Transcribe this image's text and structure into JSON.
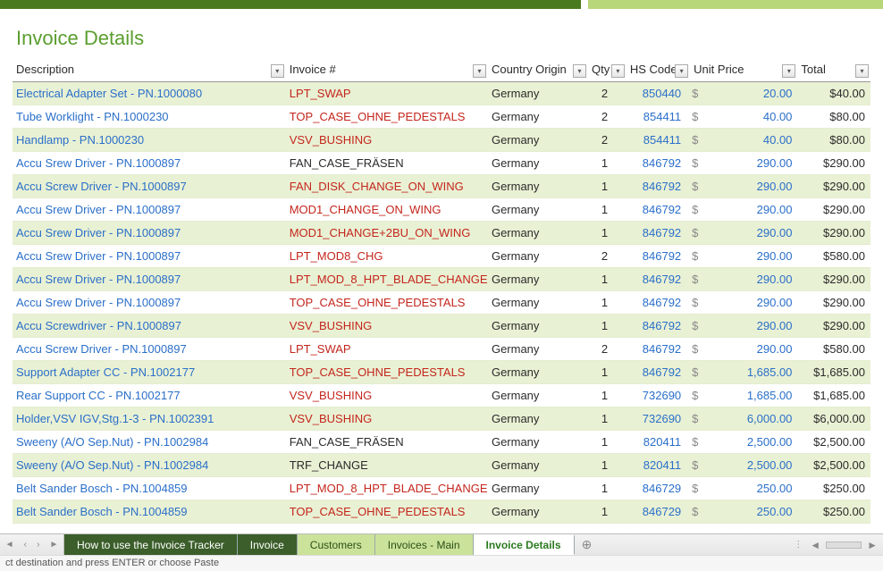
{
  "title": "Invoice Details",
  "columns": {
    "description": "Description",
    "invoice": "Invoice #",
    "origin": "Country Origin",
    "qty": "Qty",
    "hs": "HS Code",
    "unit": "Unit Price",
    "total": "Total"
  },
  "currency_symbol": "$",
  "rows": [
    {
      "desc": "Electrical Adapter Set  - PN.1000080",
      "inv": "LPT_SWAP",
      "invred": true,
      "origin": "Germany",
      "qty": "2",
      "hs": "850440",
      "unit": "20.00",
      "total": "$40.00"
    },
    {
      "desc": "Tube Worklight  - PN.1000230",
      "inv": "TOP_CASE_OHNE_PEDESTALS",
      "invred": true,
      "origin": "Germany",
      "qty": "2",
      "hs": "854411",
      "unit": "40.00",
      "total": "$80.00"
    },
    {
      "desc": "Handlamp  - PN.1000230",
      "inv": "VSV_BUSHING",
      "invred": true,
      "origin": "Germany",
      "qty": "2",
      "hs": "854411",
      "unit": "40.00",
      "total": "$80.00"
    },
    {
      "desc": "Accu Srew Driver  - PN.1000897",
      "inv": "FAN_CASE_FRÄSEN",
      "invred": false,
      "origin": "Germany",
      "qty": "1",
      "hs": "846792",
      "unit": "290.00",
      "total": "$290.00"
    },
    {
      "desc": "Accu Screw Driver  - PN.1000897",
      "inv": "FAN_DISK_CHANGE_ON_WING",
      "invred": true,
      "origin": "Germany",
      "qty": "1",
      "hs": "846792",
      "unit": "290.00",
      "total": "$290.00"
    },
    {
      "desc": "Accu Srew Driver  - PN.1000897",
      "inv": "MOD1_CHANGE_ON_WING",
      "invred": true,
      "origin": "Germany",
      "qty": "1",
      "hs": "846792",
      "unit": "290.00",
      "total": "$290.00"
    },
    {
      "desc": "Accu Srew Driver  - PN.1000897",
      "inv": "MOD1_CHANGE+2BU_ON_WING",
      "invred": true,
      "origin": "Germany",
      "qty": "1",
      "hs": "846792",
      "unit": "290.00",
      "total": "$290.00"
    },
    {
      "desc": "Accu Srew Driver  - PN.1000897",
      "inv": "LPT_MOD8_CHG",
      "invred": true,
      "origin": "Germany",
      "qty": "2",
      "hs": "846792",
      "unit": "290.00",
      "total": "$580.00"
    },
    {
      "desc": "Accu Srew Driver  - PN.1000897",
      "inv": "LPT_MOD_8_HPT_BLADE_CHANGE",
      "invred": true,
      "origin": "Germany",
      "qty": "1",
      "hs": "846792",
      "unit": "290.00",
      "total": "$290.00"
    },
    {
      "desc": "Accu Srew Driver  - PN.1000897",
      "inv": "TOP_CASE_OHNE_PEDESTALS",
      "invred": true,
      "origin": "Germany",
      "qty": "1",
      "hs": "846792",
      "unit": "290.00",
      "total": "$290.00"
    },
    {
      "desc": "Accu Screwdriver  - PN.1000897",
      "inv": "VSV_BUSHING",
      "invred": true,
      "origin": "Germany",
      "qty": "1",
      "hs": "846792",
      "unit": "290.00",
      "total": "$290.00"
    },
    {
      "desc": "Accu Screw Driver  - PN.1000897",
      "inv": "LPT_SWAP",
      "invred": true,
      "origin": "Germany",
      "qty": "2",
      "hs": "846792",
      "unit": "290.00",
      "total": "$580.00"
    },
    {
      "desc": "Support Adapter CC  - PN.1002177",
      "inv": "TOP_CASE_OHNE_PEDESTALS",
      "invred": true,
      "origin": "Germany",
      "qty": "1",
      "hs": "846792",
      "unit": "1,685.00",
      "total": "$1,685.00"
    },
    {
      "desc": "Rear Support CC  - PN.1002177",
      "inv": "VSV_BUSHING",
      "invred": true,
      "origin": "Germany",
      "qty": "1",
      "hs": "732690",
      "unit": "1,685.00",
      "total": "$1,685.00"
    },
    {
      "desc": "Holder,VSV IGV,Stg.1-3  - PN.1002391",
      "inv": "VSV_BUSHING",
      "invred": true,
      "origin": "Germany",
      "qty": "1",
      "hs": "732690",
      "unit": "6,000.00",
      "total": "$6,000.00"
    },
    {
      "desc": "Sweeny (A/O Sep.Nut)  - PN.1002984",
      "inv": "FAN_CASE_FRÄSEN",
      "invred": false,
      "origin": "Germany",
      "qty": "1",
      "hs": "820411",
      "unit": "2,500.00",
      "total": "$2,500.00"
    },
    {
      "desc": "Sweeny (A/O Sep.Nut)  - PN.1002984",
      "inv": "TRF_CHANGE",
      "invred": false,
      "origin": "Germany",
      "qty": "1",
      "hs": "820411",
      "unit": "2,500.00",
      "total": "$2,500.00"
    },
    {
      "desc": "Belt Sander Bosch  - PN.1004859",
      "inv": "LPT_MOD_8_HPT_BLADE_CHANGE",
      "invred": true,
      "origin": "Germany",
      "qty": "1",
      "hs": "846729",
      "unit": "250.00",
      "total": "$250.00"
    },
    {
      "desc": "Belt Sander Bosch  - PN.1004859",
      "inv": "TOP_CASE_OHNE_PEDESTALS",
      "invred": true,
      "origin": "Germany",
      "qty": "1",
      "hs": "846729",
      "unit": "250.00",
      "total": "$250.00"
    }
  ],
  "tabs": {
    "howto": "How to use the Invoice Tracker",
    "invoice": "Invoice",
    "customers": "Customers",
    "main": "Invoices - Main",
    "details": "Invoice Details"
  },
  "status": "ct destination and press ENTER or choose Paste"
}
